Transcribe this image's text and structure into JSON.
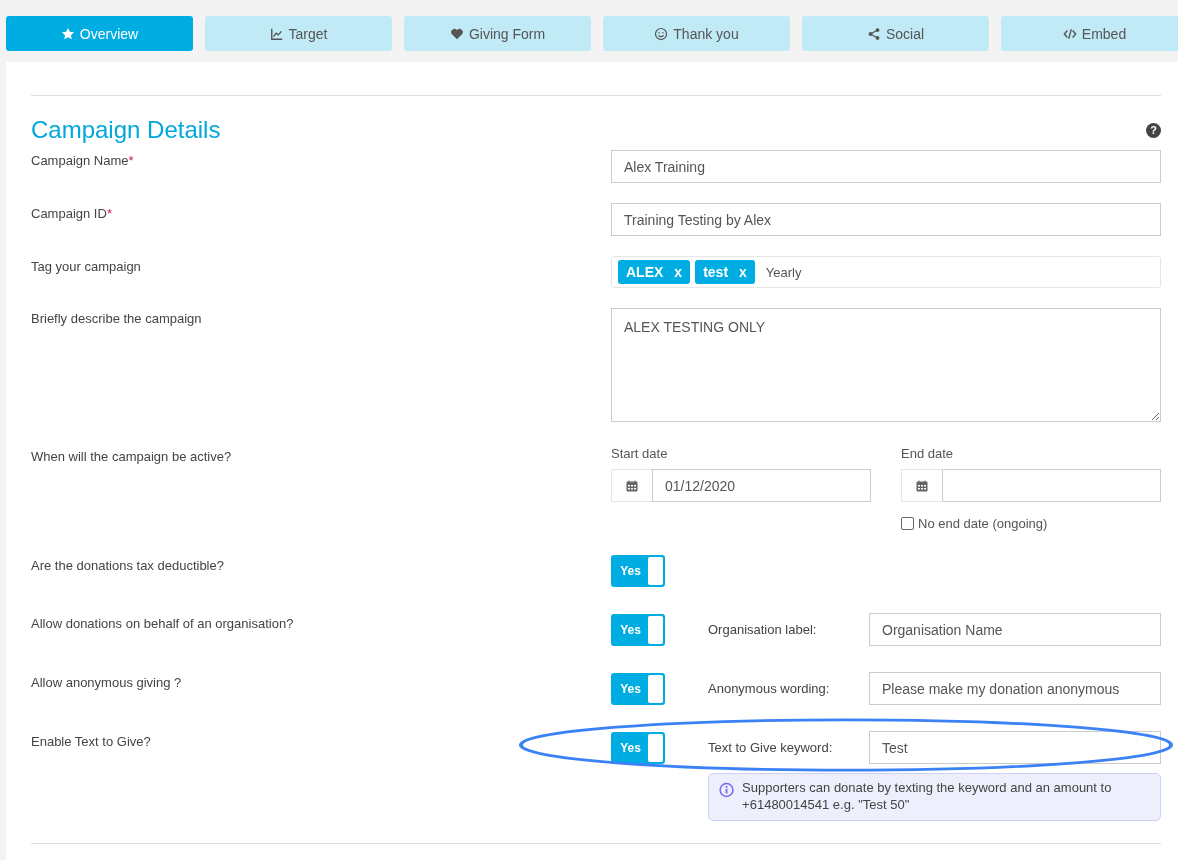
{
  "tabs": [
    {
      "label": "Overview",
      "selected": true
    },
    {
      "label": "Target",
      "selected": false
    },
    {
      "label": "Giving Form",
      "selected": false
    },
    {
      "label": "Thank you",
      "selected": false
    },
    {
      "label": "Social",
      "selected": false
    },
    {
      "label": "Embed",
      "selected": false
    }
  ],
  "section": {
    "title": "Campaign Details",
    "help": "?"
  },
  "fields": [
    {
      "kind": "text",
      "label": "Campaign Name",
      "required_mark": "*",
      "value": "Alex Training"
    },
    {
      "kind": "text",
      "label": "Campaign ID",
      "required_mark": "*",
      "value": "Training Testing by Alex"
    },
    {
      "kind": "tags",
      "label": "Tag your campaign",
      "tags": [
        {
          "text": "ALEX",
          "remove": "x"
        },
        {
          "text": "test",
          "remove": "x"
        }
      ],
      "value": "Yearly"
    },
    {
      "kind": "textarea",
      "label": "Briefly describe the campaign",
      "value": "ALEX TESTING ONLY"
    },
    {
      "kind": "dates",
      "label": "When will the campaign be active?",
      "start_label": "Start date",
      "start_value": "01/12/2020",
      "end_label": "End date",
      "ongoing": {
        "label": "No end date (ongoing)",
        "checked": false
      }
    },
    {
      "kind": "toggle",
      "label": "Are the donations tax deductible?",
      "toggle": {
        "text": "Yes",
        "on": true
      }
    },
    {
      "kind": "toggle",
      "label": "Allow donations on behalf of an organisation?",
      "toggle": {
        "text": "Yes",
        "on": true
      },
      "sub_label": "Organisation label:",
      "sub_value": "Organisation Name"
    },
    {
      "kind": "toggle",
      "label": "Allow anonymous giving ?",
      "toggle": {
        "text": "Yes",
        "on": true
      },
      "sub_label": "Anonymous wording:",
      "sub_value": "Please make my donation anonymous"
    },
    {
      "kind": "toggle",
      "label": "Enable Text to Give?",
      "toggle": {
        "text": "Yes",
        "on": true
      },
      "sub_label": "Text to Give keyword:",
      "sub_value": "Test",
      "info": "Supporters can donate by texting the keyword and an amount to +61480014541 e.g. \"Test 50\"",
      "highlighted": true
    }
  ]
}
